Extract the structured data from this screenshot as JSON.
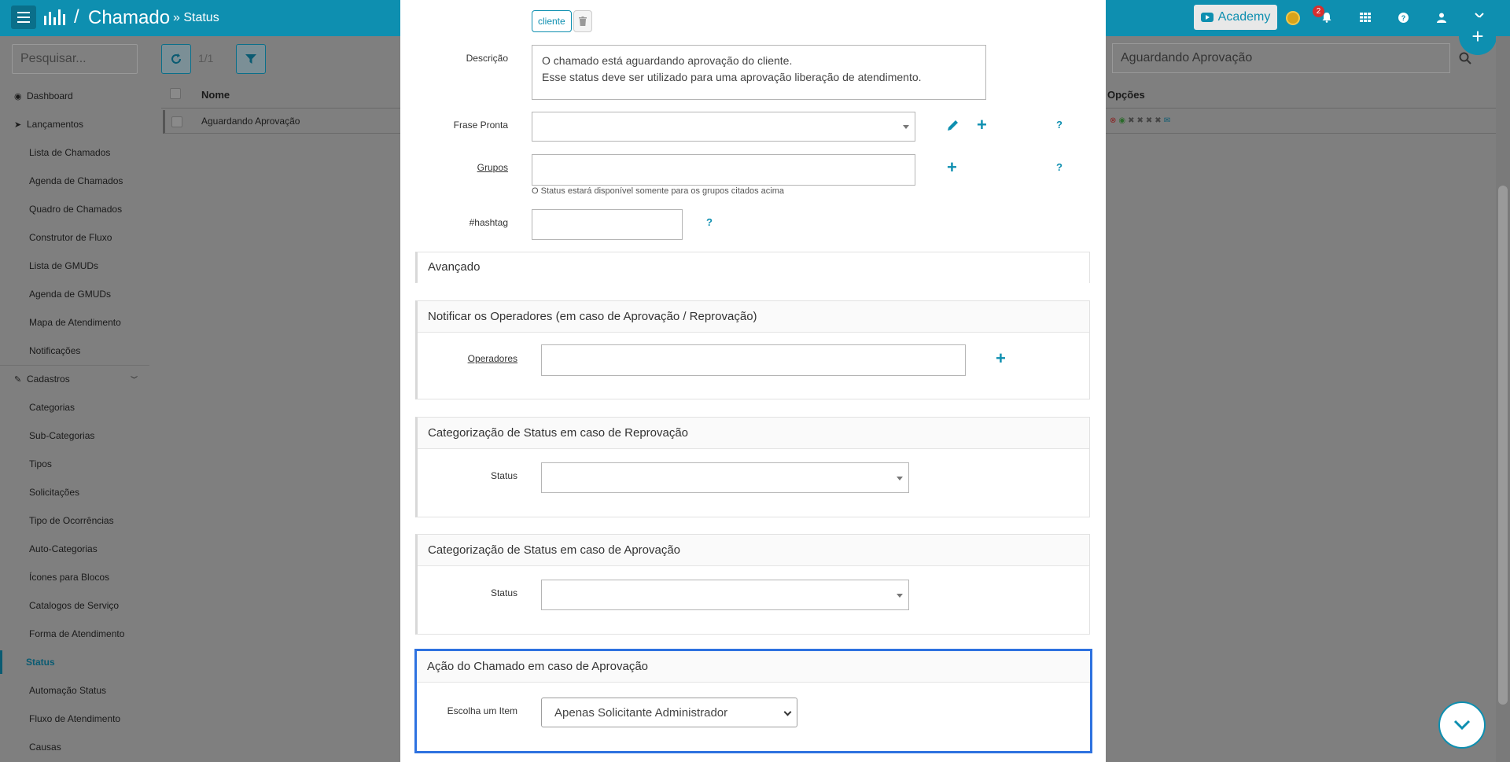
{
  "topbar": {
    "breadcrumb_separator": "/",
    "module_title": "Chamado",
    "page_subtitle": "» Status",
    "academy_label": "Academy",
    "notification_count": "2"
  },
  "sidebar": {
    "search_placeholder": "Pesquisar...",
    "items": [
      {
        "label": "Dashboard"
      },
      {
        "label": "Lançamentos"
      },
      {
        "label": "Lista de Chamados"
      },
      {
        "label": "Agenda de Chamados"
      },
      {
        "label": "Quadro de Chamados"
      },
      {
        "label": "Construtor de Fluxo"
      },
      {
        "label": "Lista de GMUDs"
      },
      {
        "label": "Agenda de GMUDs"
      },
      {
        "label": "Mapa de Atendimento"
      },
      {
        "label": "Notificações"
      },
      {
        "label": "Cadastros"
      },
      {
        "label": "Categorias"
      },
      {
        "label": "Sub-Categorias"
      },
      {
        "label": "Tipos"
      },
      {
        "label": "Solicitações"
      },
      {
        "label": "Tipo de Ocorrências"
      },
      {
        "label": "Auto-Categorias"
      },
      {
        "label": "Ícones para Blocos"
      },
      {
        "label": "Catalogos de Serviço"
      },
      {
        "label": "Forma de Atendimento"
      },
      {
        "label": "Status"
      },
      {
        "label": "Automação Status"
      },
      {
        "label": "Fluxo de Atendimento"
      },
      {
        "label": "Causas"
      }
    ]
  },
  "list": {
    "pager": "1/1",
    "col_nome": "Nome",
    "col_opcoes": "Opções",
    "rows": [
      {
        "nome": "Aguardando Aprovação"
      }
    ],
    "search_value": "Aguardando Aprovação"
  },
  "modal": {
    "tag_label": "cliente",
    "descricao_label": "Descrição",
    "descricao_value": "O chamado está aguardando aprovação do cliente.\nEsse status deve ser utilizado para uma aprovação liberação de atendimento.",
    "frase_pronta_label": "Frase Pronta",
    "grupos_label": "Grupos",
    "grupos_hint": "O Status estará disponível somente para os grupos citados acima",
    "hashtag_label": "#hashtag",
    "help_glyph": "?",
    "avancado_title": "Avançado",
    "notificar_title": "Notificar os Operadores (em caso de Aprovação / Reprovação)",
    "operadores_label": "Operadores",
    "reprovacao_title": "Categorização de Status em caso de Reprovação",
    "aprovacao_title": "Categorização de Status em caso de Aprovação",
    "status_label": "Status",
    "acao_title": "Ação do Chamado em caso de Aprovação",
    "escolha_label": "Escolha um Item",
    "escolha_value": "Apenas Solicitante Administrador"
  }
}
